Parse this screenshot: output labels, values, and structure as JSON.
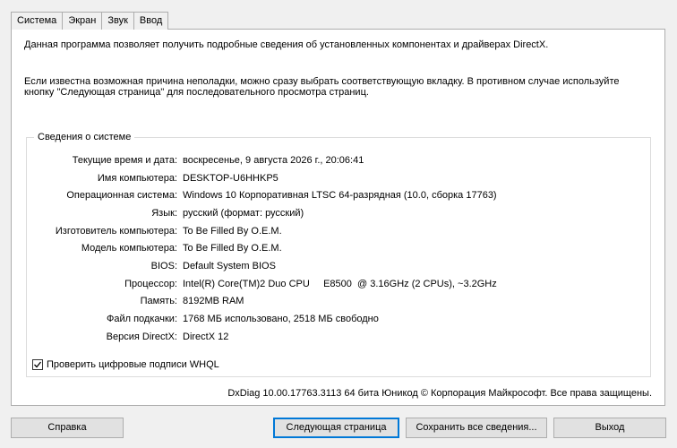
{
  "tabs": [
    "Система",
    "Экран",
    "Звук",
    "Ввод"
  ],
  "intro": {
    "line1": "Данная программа позволяет получить подробные сведения об установленных компонентах и драйверах DirectX.",
    "line2": "Если известна возможная причина неполадки, можно сразу выбрать соответствующую вкладку. В противном случае используйте",
    "line3": "кнопку \"Следующая страница\" для последовательного просмотра страниц."
  },
  "system_info": {
    "title": "Сведения о системе",
    "rows": [
      {
        "label": "Текущие время и дата:",
        "value": "воскресенье, 9 августа 2026 г., 20:06:41"
      },
      {
        "label": "Имя компьютера:",
        "value": "DESKTOP-U6HHKP5"
      },
      {
        "label": "Операционная система:",
        "value": "Windows 10 Корпоративная LTSC 64-разрядная (10.0, сборка 17763)"
      },
      {
        "label": "Язык:",
        "value": "русский (формат: русский)"
      },
      {
        "label": "Изготовитель компьютера:",
        "value": "To Be Filled By O.E.M."
      },
      {
        "label": "Модель компьютера:",
        "value": "To Be Filled By O.E.M."
      },
      {
        "label": "BIOS:",
        "value": "Default System BIOS"
      },
      {
        "label": "Процессор:",
        "value": "Intel(R) Core(TM)2 Duo CPU     E8500  @ 3.16GHz (2 CPUs), ~3.2GHz"
      },
      {
        "label": "Память:",
        "value": "8192MB RAM"
      },
      {
        "label": "Файл подкачки:",
        "value": "1768 МБ использовано, 2518 МБ свободно"
      },
      {
        "label": "Версия DirectX:",
        "value": "DirectX 12"
      }
    ]
  },
  "whql": {
    "label": "Проверить цифровые подписи WHQL",
    "checked": true
  },
  "footer": "DxDiag 10.00.17763.3113 64 бита Юникод  © Корпорация Майкрософт. Все права защищены.",
  "buttons": {
    "help": "Справка",
    "next": "Следующая страница",
    "save": "Сохранить все сведения...",
    "exit": "Выход"
  }
}
